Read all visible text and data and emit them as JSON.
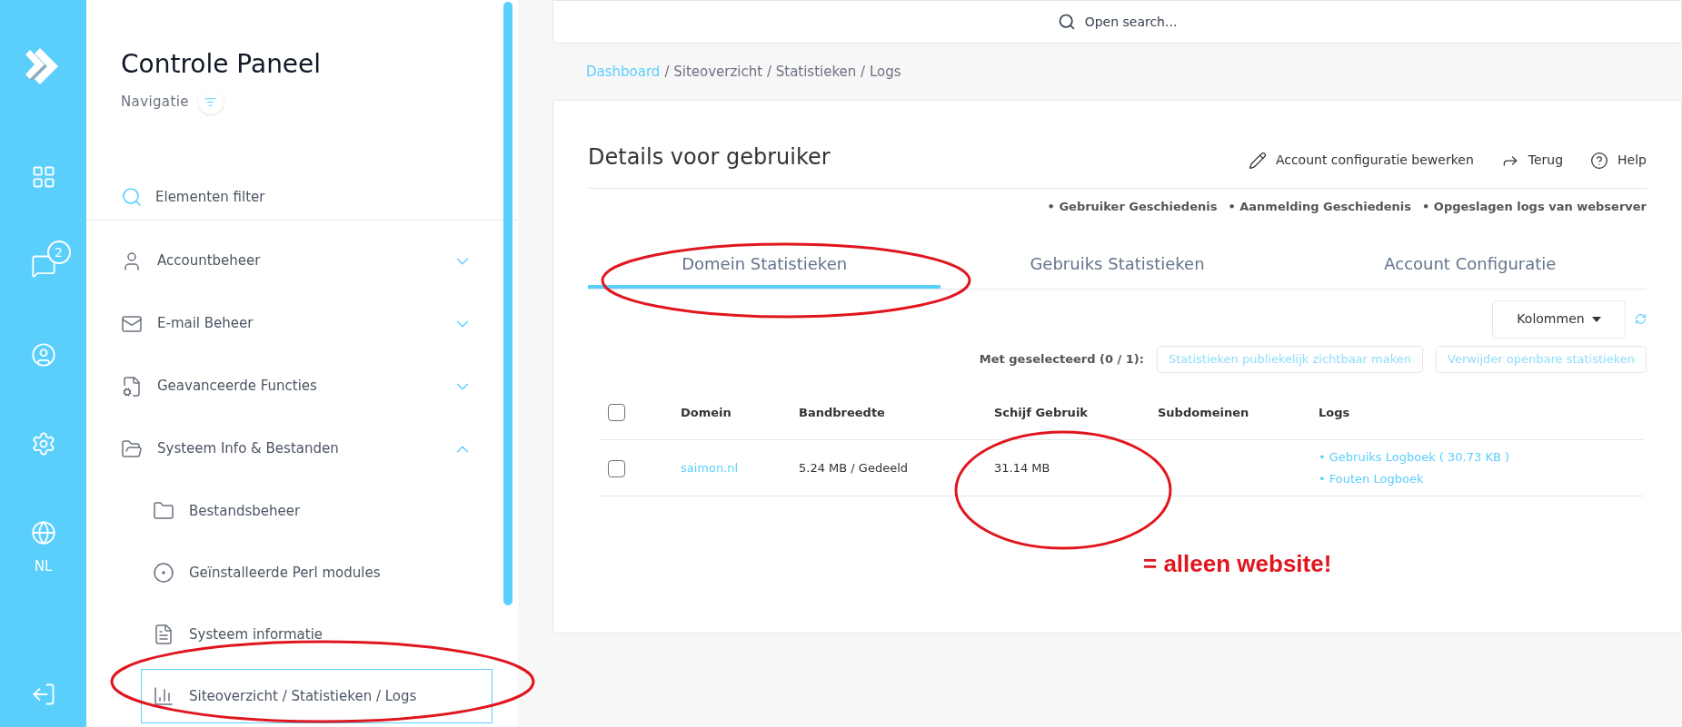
{
  "rail": {
    "chat_badge": "2",
    "language": "NL"
  },
  "sidebar": {
    "title": "Controle Paneel",
    "subtitle": "Navigatie",
    "filter_placeholder": "Elementen filter",
    "items": [
      {
        "label": "Accountbeheer",
        "expanded": false
      },
      {
        "label": "E-mail Beheer",
        "expanded": false
      },
      {
        "label": "Geavanceerde Functies",
        "expanded": false
      },
      {
        "label": "Systeem Info & Bestanden",
        "expanded": true,
        "children": [
          {
            "label": "Bestandsbeheer",
            "selected": false
          },
          {
            "label": "Geïnstalleerde Perl modules",
            "selected": false
          },
          {
            "label": "Systeem informatie",
            "selected": false
          },
          {
            "label": "Siteoverzicht / Statistieken / Logs",
            "selected": true
          }
        ]
      }
    ]
  },
  "search": {
    "placeholder": "Open search..."
  },
  "breadcrumb": {
    "link": "Dashboard",
    "path": "/ Siteoverzicht / Statistieken / Logs"
  },
  "card": {
    "title": "Details voor gebruiker",
    "actions": [
      "Account configuratie bewerken",
      "Terug",
      "Help"
    ],
    "links": [
      "• Gebruiker Geschiedenis",
      "• Aanmelding Geschiedenis",
      "• Opgeslagen logs van webserver"
    ],
    "tabs": [
      {
        "label": "Domein Statistieken",
        "selected": true
      },
      {
        "label": "Gebruiks Statistieken",
        "selected": false
      },
      {
        "label": "Account Configuratie",
        "selected": false
      }
    ],
    "columns_button": "Kolommen",
    "selection_label": "Met geselecteerd (0 / 1):",
    "bulk_buttons": [
      {
        "label": "Statistieken publiekelijk zichtbaar maken",
        "disabled": true
      },
      {
        "label": "Verwijder openbare statistieken",
        "disabled": true
      }
    ],
    "table": {
      "header_checked": false,
      "columns": [
        "Domein",
        "Bandbreedte",
        "Schijf Gebruik",
        "Subdomeinen",
        "Logs"
      ],
      "rows": [
        {
          "checked": false,
          "domain": "saimon.nl",
          "bandwidth": "5.24 MB / Gedeeld",
          "disk": "31.14 MB",
          "logs": [
            "• Gebruiks Logboek ( 30.73 KB )",
            "• Fouten Logboek"
          ]
        }
      ]
    }
  },
  "annotation": {
    "text": "= alleen website!"
  }
}
